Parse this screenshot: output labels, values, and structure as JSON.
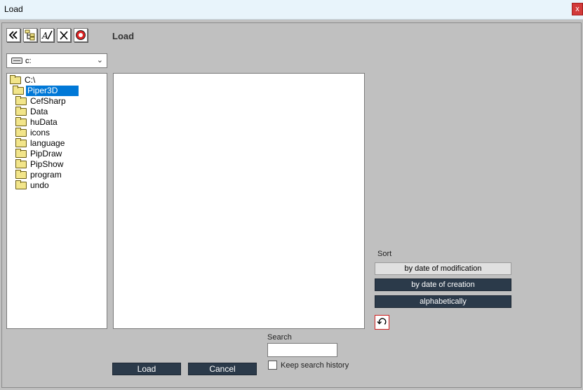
{
  "window": {
    "title": "Load",
    "close_glyph": "x"
  },
  "toolbar": {
    "buttons": [
      {
        "name": "back-icon"
      },
      {
        "name": "tree-icon"
      },
      {
        "name": "rename-icon"
      },
      {
        "name": "delete-icon"
      },
      {
        "name": "cancel-icon"
      }
    ]
  },
  "dialog": {
    "heading": "Load"
  },
  "drive": {
    "selected": "c:",
    "icon": "drive-icon"
  },
  "tree": {
    "root": "C:\\",
    "selected": "Piper3D",
    "children": [
      "CefSharp",
      "Data",
      "huData",
      "icons",
      "language",
      "PipDraw",
      "PipShow",
      "program",
      "undo"
    ]
  },
  "sort": {
    "label": "Sort",
    "options": [
      "by date of modification",
      "by date of creation",
      "alphabetically"
    ],
    "active": "by date of modification",
    "reverse_icon": "reverse-order-icon"
  },
  "search": {
    "label": "Search",
    "value": "",
    "keep_history_label": "Keep search history",
    "keep_history_checked": false
  },
  "actions": {
    "load_label": "Load",
    "cancel_label": "Cancel"
  },
  "colors": {
    "accent_dark": "#2b3a4a",
    "selection": "#0078d7",
    "titlebar": "#e8f4fb",
    "close": "#d23a3a"
  }
}
